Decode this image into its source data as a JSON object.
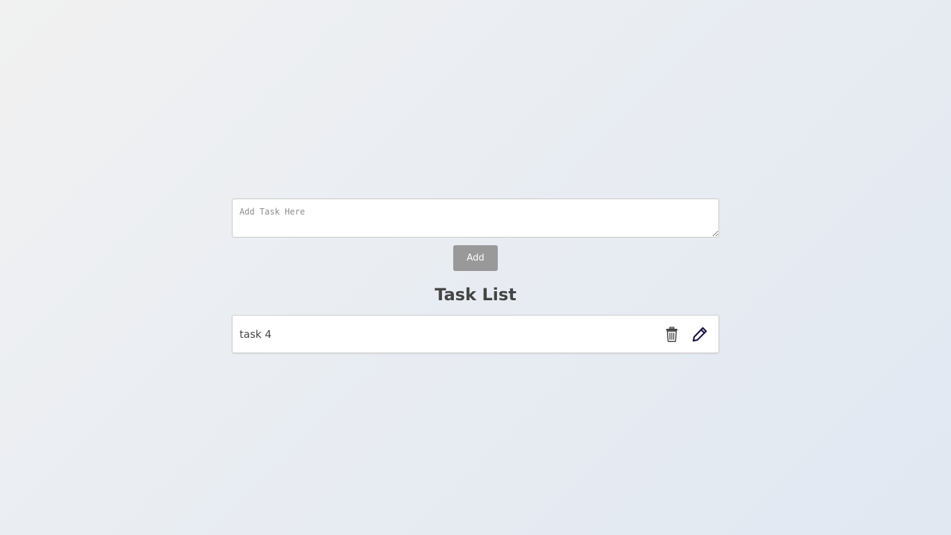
{
  "input": {
    "placeholder": "Add Task Here",
    "value": ""
  },
  "add_button": {
    "label": "Add"
  },
  "list": {
    "title": "Task List",
    "items": [
      {
        "text": "task 4",
        "delete_icon": "trash-icon",
        "edit_icon": "pencil-icon"
      }
    ]
  },
  "colors": {
    "button_bg": "#999999",
    "title": "#444444",
    "edit_icon": "#1a1440",
    "delete_icon": "#444444"
  }
}
